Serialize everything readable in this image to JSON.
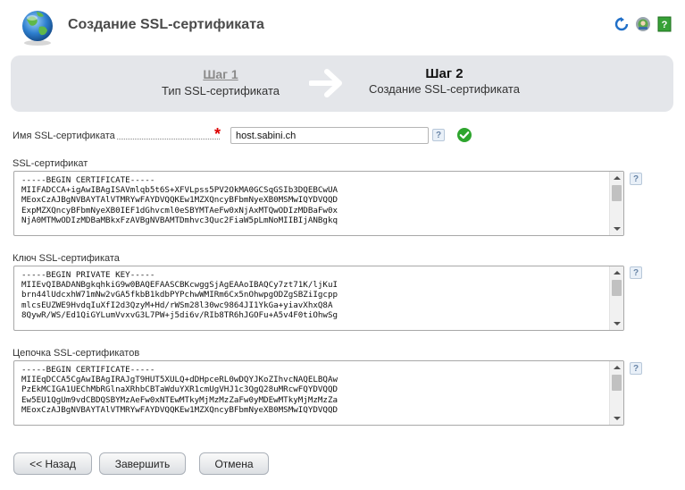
{
  "page": {
    "title": "Создание SSL-сертификата"
  },
  "header_icons": [
    "refresh-icon",
    "support-icon",
    "help-book-icon"
  ],
  "wizard": {
    "step1": {
      "number": "Шаг 1",
      "label": "Тип SSL-сертификата"
    },
    "step2": {
      "number": "Шаг 2",
      "label": "Создание SSL-сертификата"
    }
  },
  "name_field": {
    "label": "Имя SSL-сертификата",
    "required_mark": "*",
    "value": "host.sabini.ch",
    "help": "?",
    "status": "valid"
  },
  "certificate": {
    "label": "SSL-сертификат",
    "help": "?",
    "text": "-----BEGIN CERTIFICATE-----\nMIIFADCCA+igAwIBAgISAVmlqb5t6S+XFVLpss5PV2OkMA0GCSqGSIb3DQEBCwUA\nMEoxCzAJBgNVBAYTAlVTMRYwFAYDVQQKEw1MZXQncyBFbmNyeXB0MSMwIQYDVQQD\nExpMZXQncyBFbmNyeXB0IEF1dGhvcml0eSBYMTAeFw0xNjAxMTQwODIzMDBaFw0x\nNjA0MTMwODIzMDBaMBkxFzAVBgNVBAMTDmhvc3Quc2FiaW5pLmNoMIIBIjANBgkq"
  },
  "private_key": {
    "label": "Ключ SSL-сертификата",
    "help": "?",
    "text": "-----BEGIN PRIVATE KEY-----\nMIIEvQIBADANBgkqhkiG9w0BAQEFAASCBKcwggSjAgEAAoIBAQCy7zt71K/ljKuI\nbrn44lUdcxhW71mNw2vGA5fkbB1kdbPYPchwWMIRm6Cx5nOhwpgODZgSBZiIgcpp\nmlcsEUZWE9HvdqIuXfI2d3QzyM+Hd/rWSm28l30wc9864JI1YkGa+yiavXhxQ8A\n8QywR/WS/Ed1QiGYLumVvxvG3L7PW+j5di6v/RIb8TR6hJGOFu+A5v4F0tiOhwSg"
  },
  "chain": {
    "label": "Цепочка SSL-сертификатов",
    "help": "?",
    "text": "-----BEGIN CERTIFICATE-----\nMIIEqDCCA5CgAwIBAgIRAJgT9HUT5XULQ+dDHpceRL0wDQYJKoZIhvcNAQELBQAw\nPzEkMCIGA1UEChMbRGlnaXRhbCBTaWduYXR1cmUgVHJ1c3QgQ28uMRcwFQYDVQQD\nEw5EU1QgUm9vdCBDQSBYMzAeFw0xNTEwMTkyMjMzMzZaFw0yMDEwMTkyMjMzMzZa\nMEoxCzAJBgNVBAYTAlVTMRYwFAYDVQQKEw1MZXQncyBFbmNyeXB0MSMwIQYDVQQD"
  },
  "buttons": {
    "back": "<< Назад",
    "finish": "Завершить",
    "cancel": "Отмена"
  },
  "colors": {
    "wizard_bg": "#e4e6ea",
    "required": "#dd0000",
    "valid_check": "#2ea52e"
  }
}
